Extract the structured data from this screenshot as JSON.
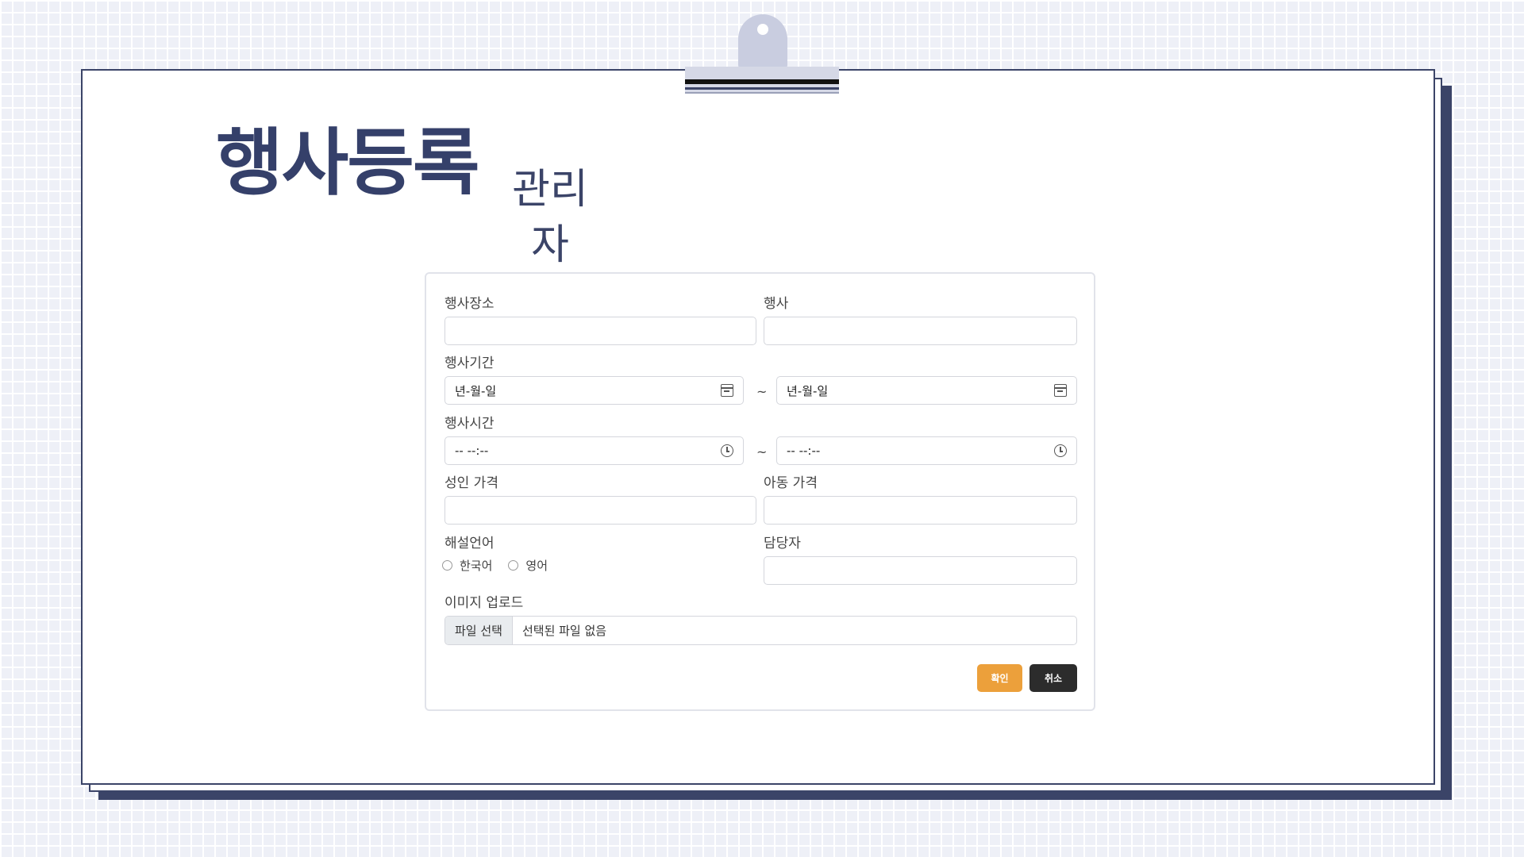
{
  "header": {
    "title": "행사등록",
    "subtitle_line1": "관리",
    "subtitle_line2": "자"
  },
  "form": {
    "venue_label": "행사장소",
    "event_label": "행사",
    "period_label": "행사기간",
    "period_start_placeholder": "년-월-일",
    "period_end_placeholder": "년-월-일",
    "time_label": "행사시간",
    "time_start_placeholder": "-- --:--",
    "time_end_placeholder": "-- --:--",
    "range_separator": "~",
    "adult_price_label": "성인 가격",
    "child_price_label": "아동 가격",
    "language_label": "해설언어",
    "language_options": [
      "한국어",
      "영어"
    ],
    "manager_label": "담당자",
    "image_upload_label": "이미지 업로드",
    "file_button_label": "파일 선택",
    "file_status": "선택된 파일 없음",
    "confirm_label": "확인",
    "cancel_label": "취소"
  },
  "colors": {
    "accent": "#eca03b",
    "dark_button": "#2c2c2c",
    "frame": "#3b4468",
    "title": "#35406a"
  },
  "icons": {
    "date_picker": "calendar-icon",
    "time_picker": "clock-icon"
  }
}
